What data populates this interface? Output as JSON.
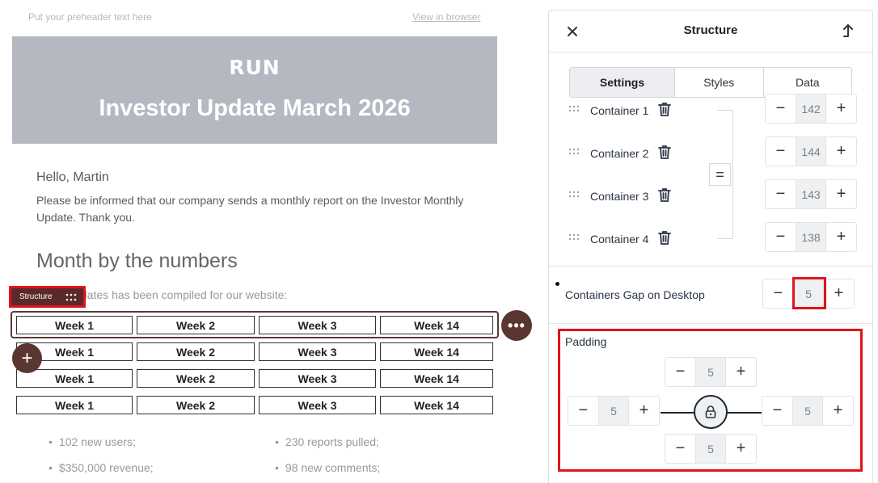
{
  "email": {
    "preheader": "Put your preheader text here",
    "view_in_browser": "View in browser",
    "logo": "RUN",
    "title": "Investor Update March 2026",
    "greeting": "Hello, Martin",
    "intro": "Please be informed that our company sends a monthly report on the Investor Monthly Update. Thank you.",
    "section_title": "Month by the numbers",
    "section_sub": "dates has been compiled for our website:",
    "structure_tag": "Structure",
    "more_button": "•••",
    "add_button": "+",
    "week_rows": [
      [
        "Week 1",
        "Week 2",
        "Week 3",
        "Week 14"
      ],
      [
        "Week 1",
        "Week 2",
        "Week 3",
        "Week 14"
      ],
      [
        "Week 1",
        "Week 2",
        "Week 3",
        "Week 14"
      ],
      [
        "Week 1",
        "Week 2",
        "Week 3",
        "Week 14"
      ]
    ],
    "bullets": [
      [
        "102 new users;",
        "230 reports pulled;"
      ],
      [
        "$350,000 revenue;",
        "98 new comments;"
      ]
    ]
  },
  "panel": {
    "title": "Structure",
    "close_icon": "close-icon",
    "collapse_icon": "collapse-icon",
    "tabs": [
      {
        "label": "Settings",
        "active": true
      },
      {
        "label": "Styles",
        "active": false
      },
      {
        "label": "Data",
        "active": false
      }
    ],
    "containers": [
      {
        "label": "Container 1",
        "value": "142"
      },
      {
        "label": "Container 2",
        "value": "144"
      },
      {
        "label": "Container 3",
        "value": "143"
      },
      {
        "label": "Container 4",
        "value": "138"
      }
    ],
    "equal_button": "=",
    "gap": {
      "label": "Containers Gap on Desktop",
      "value": "5"
    },
    "padding": {
      "label": "Padding",
      "top": "5",
      "left": "5",
      "right": "5",
      "bottom": "5"
    },
    "minus": "−",
    "plus": "+",
    "accent_color": "#e0141a",
    "button_color": "#5a3630"
  }
}
